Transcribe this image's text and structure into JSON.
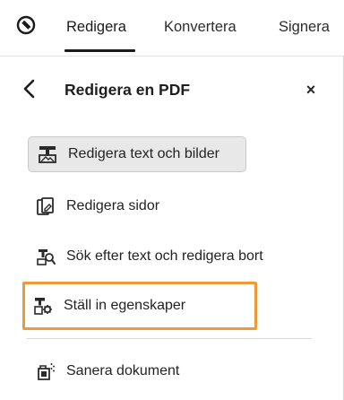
{
  "topbar": {
    "app_icon": "acrobat-tools-icon",
    "tabs": [
      {
        "label": "Redigera",
        "active": true
      },
      {
        "label": "Konvertera",
        "active": false
      },
      {
        "label": "Signera",
        "active": false
      }
    ]
  },
  "panel": {
    "back_icon": "chevron-left-icon",
    "title": "Redigera en PDF",
    "close_label": "×",
    "items": [
      {
        "label": "Redigera text och bilder",
        "icon": "edit-text-images-icon",
        "selected": true
      },
      {
        "label": "Redigera sidor",
        "icon": "edit-pages-icon"
      },
      {
        "label": "Sök efter text och redigera bort",
        "icon": "find-redact-icon"
      },
      {
        "label": "Ställ in egenskaper",
        "icon": "set-properties-icon",
        "highlighted": true
      },
      {
        "label": "Sanera dokument",
        "icon": "sanitize-document-icon"
      }
    ]
  },
  "colors": {
    "highlight_border": "#ec9a3a",
    "selected_bg": "#e8e8e8",
    "tab_underline": "#1b1b1b"
  }
}
